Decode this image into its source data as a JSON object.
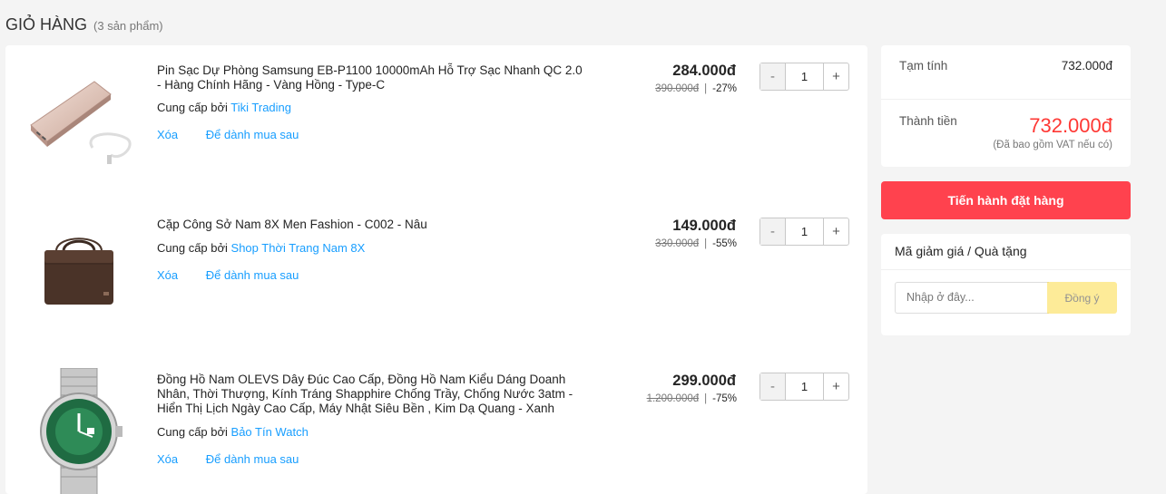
{
  "page": {
    "title": "Giỏ hàng",
    "count": "(3 sản phẩm)"
  },
  "items": [
    {
      "name": "Pin Sạc Dự Phòng Samsung EB-P1100 10000mAh Hỗ Trợ Sạc Nhanh QC 2.0 - Hàng Chính Hãng - Vàng Hồng - Type-C",
      "seller_prefix": "Cung cấp bởi",
      "seller": "Tiki Trading",
      "delete_label": "Xóa",
      "save_label": "Để dành mua sau",
      "price": "284.000đ",
      "old_price": "390.000đ",
      "sep": "|",
      "discount": "-27%",
      "qty_minus": "-",
      "qty": "1",
      "qty_plus": "+"
    },
    {
      "name": "Cặp Công Sở Nam 8X Men Fashion - C002 - Nâu",
      "seller_prefix": "Cung cấp bởi",
      "seller": "Shop Thời Trang Nam 8X",
      "delete_label": "Xóa",
      "save_label": "Để dành mua sau",
      "price": "149.000đ",
      "old_price": "330.000đ",
      "sep": "|",
      "discount": "-55%",
      "qty_minus": "-",
      "qty": "1",
      "qty_plus": "+"
    },
    {
      "name": "Đồng Hồ Nam OLEVS Dây Đúc Cao Cấp, Đồng Hồ Nam Kiểu Dáng Doanh Nhân, Thời Thượng, Kính Tráng Shapphire Chống Trầy, Chống Nước 3atm - Hiển Thị Lịch Ngày Cao Cấp, Máy Nhật Siêu Bền , Kim Dạ Quang - Xanh",
      "seller_prefix": "Cung cấp bởi",
      "seller": "Bảo Tín Watch",
      "delete_label": "Xóa",
      "save_label": "Để dành mua sau",
      "price": "299.000đ",
      "old_price": "1.200.000đ",
      "sep": "|",
      "discount": "-75%",
      "qty_minus": "-",
      "qty": "1",
      "qty_plus": "+"
    }
  ],
  "summary": {
    "subtotal_label": "Tạm tính",
    "subtotal": "732.000đ",
    "total_label": "Thành tiền",
    "total": "732.000đ",
    "vat_note": "(Đã bao gồm VAT nếu có)"
  },
  "checkout": {
    "label": "Tiến hành đặt hàng"
  },
  "coupon": {
    "title": "Mã giảm giá / Quà tặng",
    "placeholder": "Nhập ở đây...",
    "apply_label": "Đồng ý"
  },
  "colors": {
    "accent": "#ff424e",
    "link": "#189eff",
    "total_price": "#fe3834",
    "apply_button": "#fdde54"
  }
}
